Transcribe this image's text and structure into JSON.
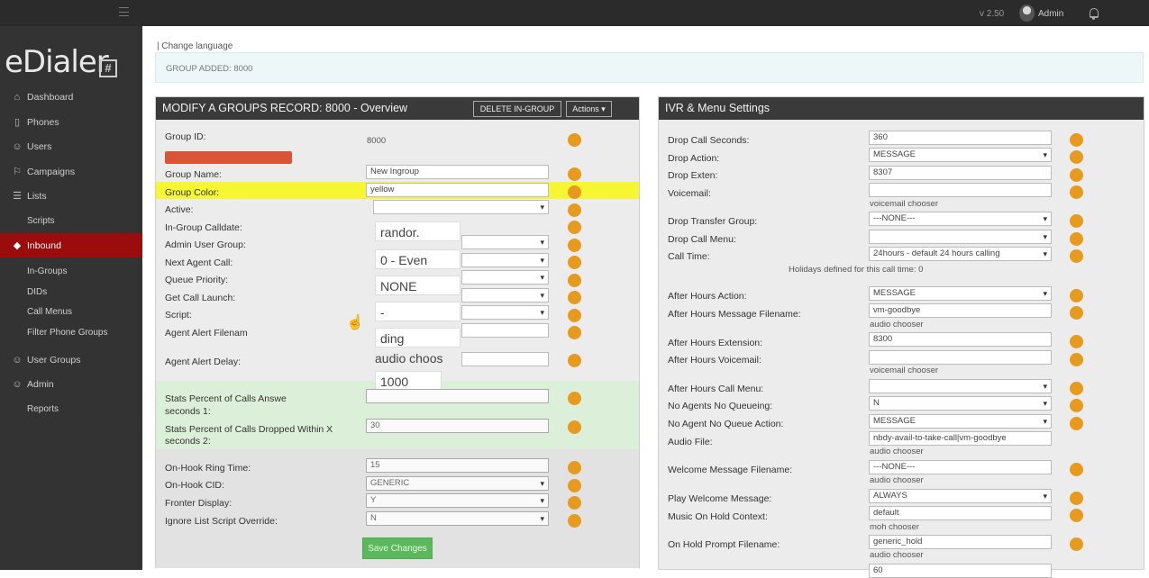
{
  "topbar": {
    "version": "v 2.50",
    "user": "Admin",
    "icons": [
      "menu-icon",
      "avatar",
      "bell-icon"
    ]
  },
  "sidebar": {
    "logo": "eDialer",
    "logo_badge": "#",
    "items": [
      {
        "label": "Dashboard",
        "icon": "home-icon"
      },
      {
        "label": "Phones",
        "icon": "phone-icon"
      },
      {
        "label": "Users",
        "icon": "users-icon"
      },
      {
        "label": "Campaigns",
        "icon": "flag-icon"
      },
      {
        "label": "Lists",
        "icon": "list-icon"
      },
      {
        "label": "Scripts",
        "icon": ""
      },
      {
        "label": "Inbound",
        "icon": "diamond-icon",
        "active": true
      },
      {
        "label": "In-Groups"
      },
      {
        "label": "DIDs"
      },
      {
        "label": "Call Menus"
      },
      {
        "label": "Filter Phone Groups"
      },
      {
        "label": "User Groups",
        "icon": "users-icon"
      },
      {
        "label": "Admin",
        "icon": "user-icon"
      },
      {
        "label": "Reports"
      }
    ]
  },
  "header": {
    "change_language": "| Change language",
    "notice": "GROUP ADDED: 8000"
  },
  "left_panel": {
    "title": "MODIFY A GROUPS RECORD: 8000 - Overview",
    "delete_btn": "DELETE IN-GROUP",
    "actions_btn": "Actions ▾",
    "group_id_label": "Group ID:",
    "group_id_value": "8000",
    "fields": [
      {
        "label": "Group Name:",
        "value": "New Ingroup"
      },
      {
        "label": "Group Color:",
        "value": "yellow"
      },
      {
        "label": "Active:",
        "value": ""
      },
      {
        "label": "In-Group Calldate:",
        "value": ""
      },
      {
        "label": "Admin User Group:",
        "value": ""
      },
      {
        "label": "Next Agent Call:",
        "value": ""
      },
      {
        "label": "Queue Priority:",
        "value": ""
      },
      {
        "label": "Get Call Launch:",
        "value": ""
      },
      {
        "label": "Script:",
        "value": ""
      },
      {
        "label": "Agent Alert Filenam",
        "value": ""
      },
      {
        "label": "Agent Alert Delay:",
        "value": ""
      },
      {
        "label": "Stats Percent of Calls Answe",
        "label2": "seconds 1:",
        "value": ""
      },
      {
        "label": "Stats Percent of Calls Dropped Within X",
        "label2": "seconds 2:",
        "value": "30"
      },
      {
        "label": "On-Hook Ring Time:",
        "value": "15"
      },
      {
        "label": "On-Hook CID:",
        "value": "GENERIC"
      },
      {
        "label": "Fronter Display:",
        "value": "Y"
      },
      {
        "label": "Ignore List Script Override:",
        "value": "N"
      }
    ],
    "zoom": {
      "calldate": "randor.",
      "next_agent": "0 - Even",
      "queue": "NONE",
      "script": "-",
      "alert_file": "ding",
      "alert_chooser": "audio choos",
      "alert_delay": "1000"
    },
    "save_btn": "Save Changes"
  },
  "right_panel": {
    "title": "IVR & Menu Settings",
    "fields": [
      {
        "label": "Drop Call Seconds:",
        "value": "360"
      },
      {
        "label": "Drop Action:",
        "value": "MESSAGE"
      },
      {
        "label": "Drop Exten:",
        "value": "8307"
      },
      {
        "label": "Voicemail:",
        "value": "",
        "note": "voicemail chooser"
      },
      {
        "label": "Drop Transfer Group:",
        "value": "---NONE---"
      },
      {
        "label": "Drop Call Menu:",
        "value": ""
      },
      {
        "label": "Call Time:",
        "value": "24hours - default 24 hours calling",
        "note": "Holidays defined for this call time: 0"
      },
      {
        "label": "After Hours Action:",
        "value": "MESSAGE"
      },
      {
        "label": "After Hours Message Filename:",
        "value": "vm-goodbye",
        "note": "audio chooser"
      },
      {
        "label": "After Hours Extension:",
        "value": "8300"
      },
      {
        "label": "After Hours Voicemail:",
        "value": "",
        "note": "voicemail chooser"
      },
      {
        "label": "After Hours Call Menu:",
        "value": ""
      },
      {
        "label": "No Agents No Queueing:",
        "value": "N"
      },
      {
        "label": "No Agent No Queue Action:",
        "value": "MESSAGE"
      },
      {
        "label": "Audio File:",
        "value": "nbdy-avail-to-take-call|vm-goodbye",
        "note": "audio chooser"
      },
      {
        "label": "Welcome Message Filename:",
        "value": "---NONE---",
        "note": "audio chooser"
      },
      {
        "label": "Play Welcome Message:",
        "value": "ALWAYS"
      },
      {
        "label": "Music On Hold Context:",
        "value": "default",
        "note": "moh chooser"
      },
      {
        "label": "On Hold Prompt Filename:",
        "value": "generic_hold",
        "note": "audio chooser"
      },
      {
        "label": "",
        "value": "60"
      }
    ]
  }
}
